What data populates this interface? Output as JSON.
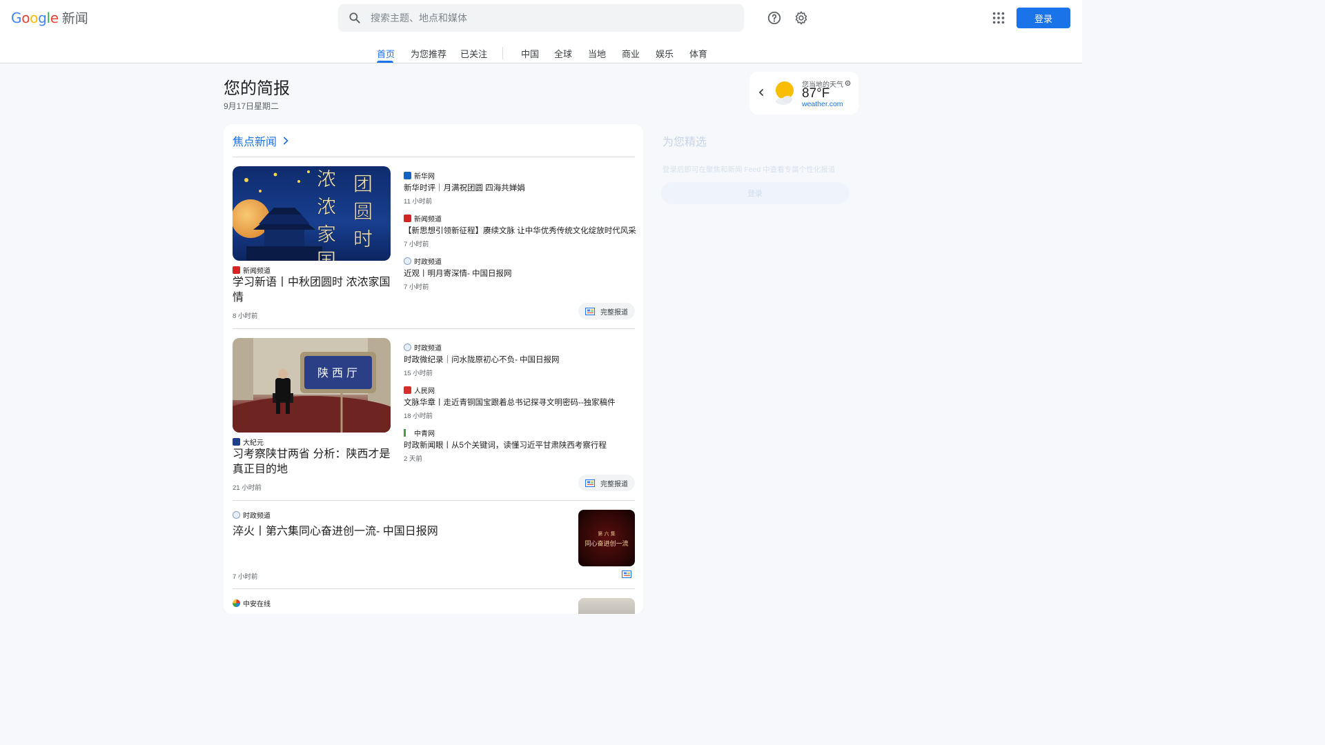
{
  "header": {
    "logo_google": "Google",
    "logo_suffix": "新闻",
    "search_placeholder": "搜索主题、地点和媒体",
    "login": "登录"
  },
  "nav": {
    "tabs": [
      "首页",
      "为您推荐",
      "已关注",
      "中国",
      "全球",
      "当地",
      "商业",
      "娱乐",
      "体育"
    ],
    "active": "首页"
  },
  "briefing": {
    "title": "您的简报",
    "date": "9月17日星期二"
  },
  "weather": {
    "location_label": "您当地的天气",
    "temp": "87°F",
    "source": "weather.com"
  },
  "top_stories": {
    "heading": "焦点新闻",
    "clusters": [
      {
        "image_text": [
          "团",
          "圆",
          "时",
          "浓",
          "浓",
          "家",
          "国"
        ],
        "source": "新闻频道",
        "title": "学习新语丨中秋团圆时 浓浓家国情",
        "time": "8 小时前",
        "related": [
          {
            "source": "新华网",
            "title": "新华时评｜月满祝团圆 四海共婵娟",
            "time": "11 小时前"
          },
          {
            "source": "新闻频道",
            "title": "【新思想引领新征程】赓续文脉 让中华优秀传统文化绽放时代风采",
            "time": "7 小时前"
          },
          {
            "source": "时政频道",
            "title": "近观丨明月寄深情- 中国日报网",
            "time": "7 小时前"
          }
        ],
        "full_coverage": "完整报道"
      },
      {
        "image_text": "陕西厅",
        "source": "大紀元",
        "title": "习考察陕甘两省 分析：陕西才是真正目的地",
        "time": "21 小时前",
        "related": [
          {
            "source": "时政频道",
            "title": "时政微纪录｜问水陇原初心不负- 中国日报网",
            "time": "15 小时前"
          },
          {
            "source": "人民网",
            "title": "文脉华章丨走近青铜国宝跟着总书记探寻文明密码--独家稿件",
            "time": "18 小时前"
          },
          {
            "source": "中青网",
            "title": "时政新闻眼丨从5个关键词，读懂习近平甘肃陕西考察行程",
            "time": "2 天前"
          }
        ],
        "full_coverage": "完整报道"
      }
    ],
    "singles": [
      {
        "source": "时政频道",
        "title": "淬火丨第六集同心奋进创一流- 中国日报网",
        "time": "7 小时前",
        "thumb_text": [
          "第 六 集",
          "同心奋进创一流"
        ]
      },
      {
        "source": "中安在线"
      }
    ]
  },
  "side_panel": {
    "heading": "为您精选",
    "text": "登录后即可在聚焦和新闻 Feed 中查看专属个性化报道",
    "button": "登录"
  }
}
